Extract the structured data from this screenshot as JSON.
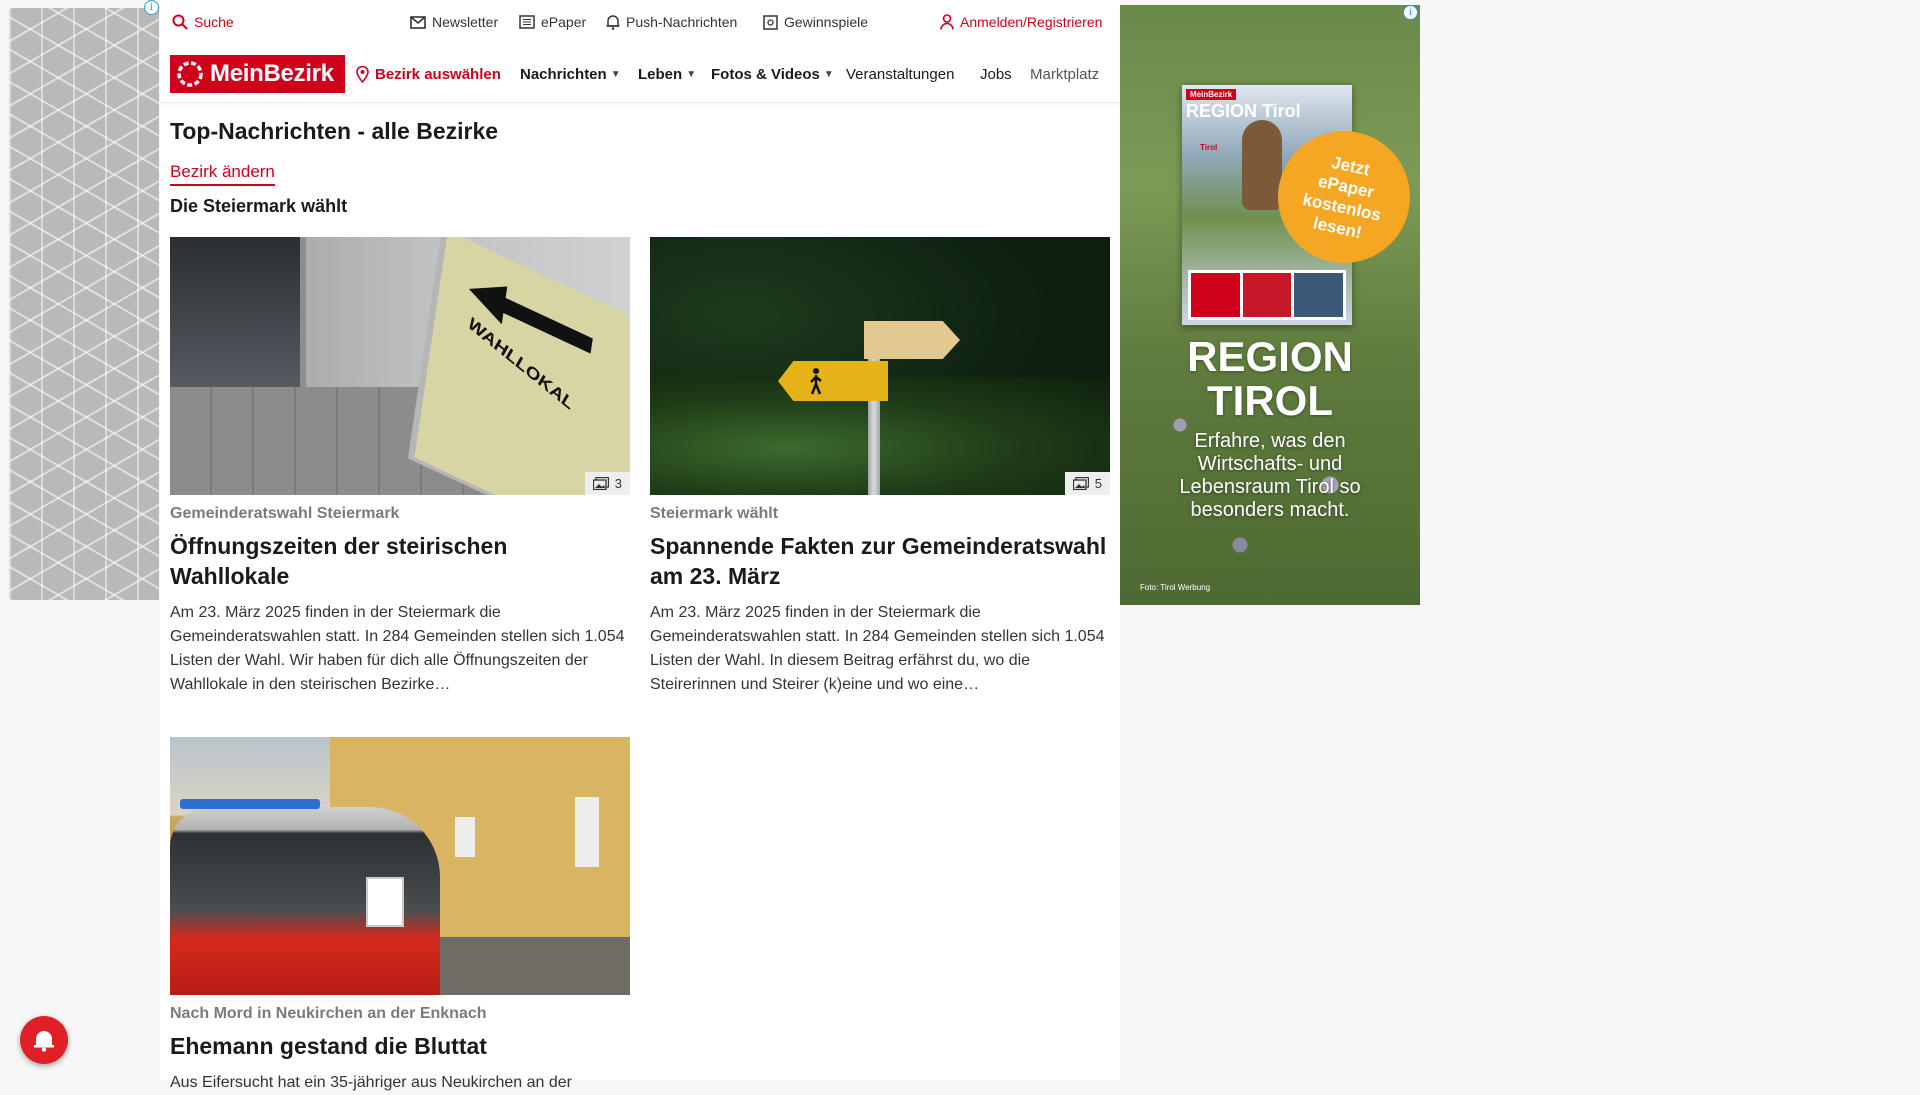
{
  "topbar": {
    "search": "Suche",
    "newsletter": "Newsletter",
    "epaper": "ePaper",
    "push": "Push-Nachrichten",
    "contests": "Gewinnspiele",
    "login": "Anmelden/Registrieren"
  },
  "nav": {
    "logo": "MeinBezirk",
    "district": "Bezirk auswählen",
    "items": [
      "Nachrichten",
      "Leben",
      "Fotos & Videos",
      "Veranstaltungen",
      "Jobs",
      "Marktplatz"
    ]
  },
  "page": {
    "title": "Top-Nachrichten - alle Bezirke",
    "change_district": "Bezirk ändern",
    "section": "Die Steiermark wählt"
  },
  "articles": [
    {
      "kicker": "Gemeinderatswahl Steiermark",
      "headline": "Öffnungszeiten der steirischen Wahllokale",
      "teaser": "Am 23. März 2025 finden in der Steiermark die Gemeinderatswahlen statt. In 284 Gemeinden stellen sich 1.054 Listen der Wahl. Wir haben für dich alle Öffnungszeiten der Wahllokale in den steirischen Bezirke…",
      "photo_count": "3",
      "image_sign": "WAHLLOKAL"
    },
    {
      "kicker": "Steiermark wählt",
      "headline": "Spannende Fakten zur Gemeinderatswahl am 23. März",
      "teaser": "Am 23. März 2025 finden in der Steiermark die Gemeinderatswahlen statt. In 284 Gemeinden stellen sich 1.054 Listen der Wahl. In diesem Beitrag erfährst du, wo die Steirerinnen und Steirer (k)eine und wo eine…",
      "photo_count": "5"
    },
    {
      "kicker": "Nach Mord in Neukirchen an der Enknach",
      "headline": "Ehemann gestand die Bluttat",
      "teaser": "Aus Eifersucht hat ein 35-jähriger aus Neukirchen an der"
    }
  ],
  "ad": {
    "badge": "MeinBezirk",
    "mag_title": "REGION Tirol",
    "mag_sub": "Tirol",
    "cta": "Jetzt ePaper kostenlos lesen!",
    "big_title_1": "REGION",
    "big_title_2": "TIROL",
    "body": "Erfahre, was den Wirtschafts- und Lebensraum Tirol so besonders macht.",
    "credit": "Foto: Tirol Werbung",
    "info": "i"
  },
  "colors": {
    "brand": "#d0021b",
    "cta": "#f5a623"
  }
}
